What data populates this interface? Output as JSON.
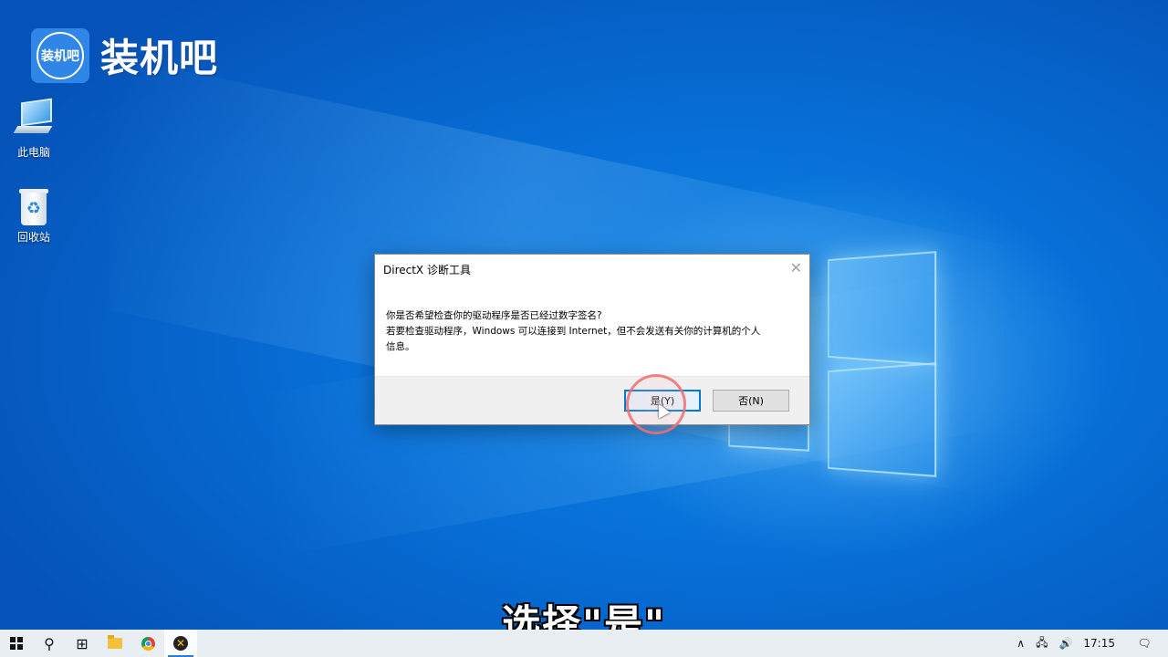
{
  "brand": {
    "badge_text": "装机吧",
    "name": "装机吧"
  },
  "desktop_icons": [
    {
      "label": "此电脑",
      "icon": "this-pc-icon"
    },
    {
      "label": "回收站",
      "icon": "recycle-bin-icon"
    }
  ],
  "dialog": {
    "title": "DirectX 诊断工具",
    "close_glyph": "✕",
    "message_lines": [
      "你是否希望检查你的驱动程序是否已经过数字签名?",
      "若要检查驱动程序，Windows 可以连接到 Internet，但不会发送有关你的计算机的个人",
      "信息。"
    ],
    "yes_label": "是(Y)",
    "no_label": "否(N)"
  },
  "subtitle": "选择\"是\"",
  "taskbar": {
    "apps": [
      "start-icon",
      "search-icon",
      "task-view-icon",
      "file-explorer-icon",
      "chrome-icon",
      "directx-icon"
    ],
    "tray": {
      "chevron": "∧",
      "network": "🖧",
      "volume": "🔊",
      "time": "17:15",
      "notification": "🗨"
    }
  },
  "colors": {
    "accent": "#0078d7",
    "desktop_blue": "#0770d8",
    "taskbar_bg": "#e9eef3"
  }
}
